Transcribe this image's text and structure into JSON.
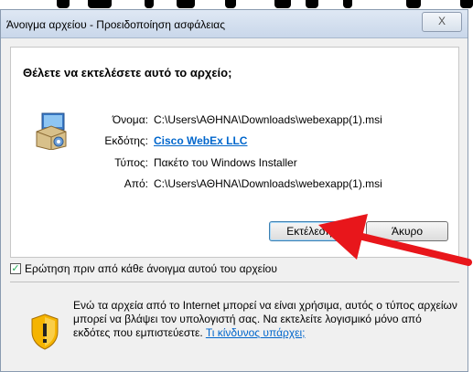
{
  "window": {
    "title": "Άνοιγμα αρχείου - Προειδοποίηση ασφάλειας",
    "close_label": "X"
  },
  "prompt": {
    "heading": "Θέλετε να εκτελέσετε αυτό το αρχείο;",
    "fields": [
      {
        "label": "Όνομα:",
        "value": "C:\\Users\\ΑΘΗΝΑ\\Downloads\\webexapp(1).msi"
      },
      {
        "label": "Εκδότης:",
        "value": "Cisco WebEx LLC"
      },
      {
        "label": "Τύπος:",
        "value": "Πακέτο του Windows Installer"
      },
      {
        "label": "Από:",
        "value": "C:\\Users\\ΑΘΗΝΑ\\Downloads\\webexapp(1).msi"
      }
    ],
    "run_button": "Εκτέλεση",
    "cancel_button": "Άκυρο"
  },
  "checkbox": {
    "label": "Ερώτηση πριν από κάθε άνοιγμα αυτού του αρχείου",
    "checked": true
  },
  "warning": {
    "text": "Ενώ τα αρχεία από το Internet μπορεί να είναι χρήσιμα, αυτός ο τύπος αρχείων μπορεί να βλάψει τον υπολογιστή σας. Να εκτελείτε λογισμικό μόνο από εκδότες που εμπιστεύεστε. ",
    "link": "Τι κίνδυνος υπάρχει;"
  },
  "colors": {
    "link": "#0066cc",
    "annotation_arrow": "#e8161b"
  },
  "icons": {
    "package": "installer-package-icon",
    "warning": "shield-warning-icon",
    "check": "✓"
  }
}
